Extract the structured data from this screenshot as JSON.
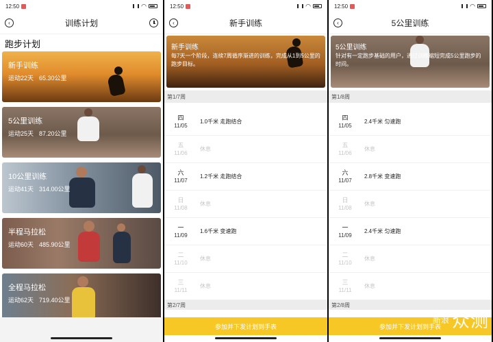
{
  "status_bar": {
    "time": "12:50"
  },
  "panel_list": {
    "nav_title": "训练计划",
    "section_title": "跑步计划",
    "plans": [
      {
        "name": "新手训练",
        "days": "运动22天",
        "distance": "65.30公里"
      },
      {
        "name": "5公里训练",
        "days": "运动25天",
        "distance": "87.20公里"
      },
      {
        "name": "10公里训练",
        "days": "运动41天",
        "distance": "314.00公里"
      },
      {
        "name": "半程马拉松",
        "days": "运动60天",
        "distance": "485.90公里"
      },
      {
        "name": "全程马拉松",
        "days": "运动62天",
        "distance": "719.40公里"
      }
    ]
  },
  "panel_beginner": {
    "nav_title": "新手训练",
    "hero_title": "新手训练",
    "hero_desc": "每7天一个阶段，连续7周循序渐进的训练，完成从1到5公里的跑步目标。",
    "week_label": "第1/7周",
    "days": [
      {
        "weekday": "四",
        "date": "11/05",
        "task": "1.0千米  走跑结合",
        "rest": false
      },
      {
        "weekday": "五",
        "date": "11/06",
        "task": "休息",
        "rest": true
      },
      {
        "weekday": "六",
        "date": "11/07",
        "task": "1.2千米  走跑结合",
        "rest": false
      },
      {
        "weekday": "日",
        "date": "11/08",
        "task": "休息",
        "rest": true
      },
      {
        "weekday": "一",
        "date": "11/09",
        "task": "1.6千米  变速跑",
        "rest": false
      },
      {
        "weekday": "二",
        "date": "11/10",
        "task": "休息",
        "rest": true
      },
      {
        "weekday": "三",
        "date": "11/11",
        "task": "休息",
        "rest": true
      }
    ],
    "next_week_label": "第2/7周",
    "cta_label": "参加并下发计划到手表"
  },
  "panel_5k": {
    "nav_title": "5公里训练",
    "hero_title": "5公里训练",
    "hero_desc": "针对有一定跑步基础的用户，通过训练缩短完成5公里跑步的时间。",
    "week_label": "第1/8周",
    "days": [
      {
        "weekday": "四",
        "date": "11/05",
        "task": "2.4千米  匀速跑",
        "rest": false
      },
      {
        "weekday": "五",
        "date": "11/06",
        "task": "休息",
        "rest": true
      },
      {
        "weekday": "六",
        "date": "11/07",
        "task": "2.8千米  变速跑",
        "rest": false
      },
      {
        "weekday": "日",
        "date": "11/08",
        "task": "休息",
        "rest": true
      },
      {
        "weekday": "一",
        "date": "11/09",
        "task": "2.4千米  匀速跑",
        "rest": false
      },
      {
        "weekday": "二",
        "date": "11/10",
        "task": "休息",
        "rest": true
      },
      {
        "weekday": "三",
        "date": "11/11",
        "task": "休息",
        "rest": true
      }
    ],
    "next_week_label": "第2/8周",
    "cta_label": "参加并下发计划到手表"
  },
  "watermark": {
    "line1": "新浪",
    "line2": "众测"
  },
  "colors": {
    "accent": "#f7c726",
    "rest_text": "#c6c6c6",
    "week_header_bg": "#ececec"
  },
  "icons": {
    "back": "back-arrow-icon",
    "history": "history-clock-icon"
  }
}
